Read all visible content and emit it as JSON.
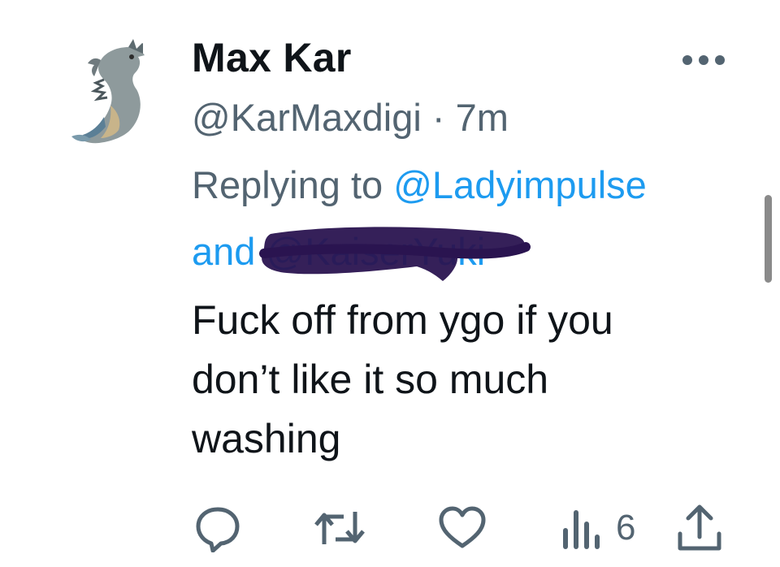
{
  "author": {
    "display_name": "Max Kar",
    "handle": "@KarMaxdigi",
    "separator": "·",
    "time": "7m"
  },
  "reply_context": {
    "prefix": "Replying to",
    "mention_1": "@Ladyimpulse",
    "conjunction": "and",
    "mention_2": "@KaiserYuki"
  },
  "tweet": {
    "lines": [
      "Fuck off from ygo if you",
      "don’t like it so much",
      "washing"
    ]
  },
  "actions": {
    "reply_icon": "reply-icon",
    "retweet_icon": "retweet-icon",
    "like_icon": "heart-icon",
    "views_icon": "views-icon",
    "views_count": "6",
    "share_icon": "share-icon"
  },
  "colors": {
    "text": "#0f1419",
    "secondary": "#536471",
    "link": "#1d9bf0",
    "scribble": "#2a1450"
  }
}
